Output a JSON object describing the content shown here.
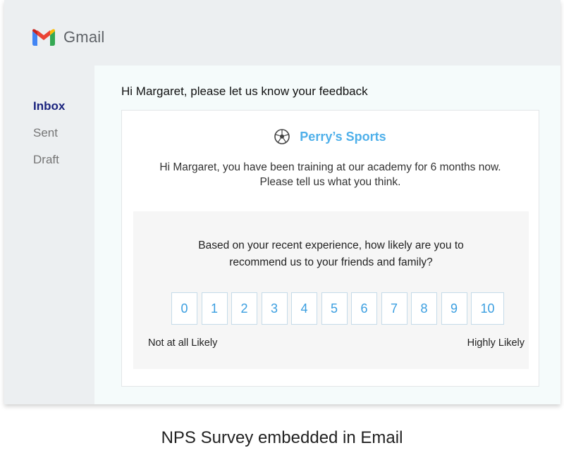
{
  "app": {
    "brand": "Gmail"
  },
  "sidebar": {
    "items": [
      {
        "label": "Inbox",
        "active": true
      },
      {
        "label": "Sent",
        "active": false
      },
      {
        "label": "Draft",
        "active": false
      }
    ]
  },
  "email": {
    "subject": "Hi Margaret, please let us know your feedback",
    "company": "Perry’s Sports",
    "greeting_line1": "Hi Margaret, you have been training at our academy for 6 months now.",
    "greeting_line2": "Please tell us what you think."
  },
  "survey": {
    "question_line1": "Based on your recent experience, how likely are you to",
    "question_line2": "recommend us to your friends and family?",
    "scores": [
      "0",
      "1",
      "2",
      "3",
      "4",
      "5",
      "6",
      "7",
      "8",
      "9",
      "10"
    ],
    "low_label": "Not at all Likely",
    "high_label": "Highly Likely"
  },
  "caption": "NPS Survey embedded in Email",
  "colors": {
    "accent": "#4fb0ea",
    "nav_active": "#1a237e",
    "window_bg": "#eceff1",
    "content_bg": "#f5fbfb"
  },
  "icons": {
    "brand": "gmail-logo-icon",
    "company": "soccer-ball-icon"
  }
}
